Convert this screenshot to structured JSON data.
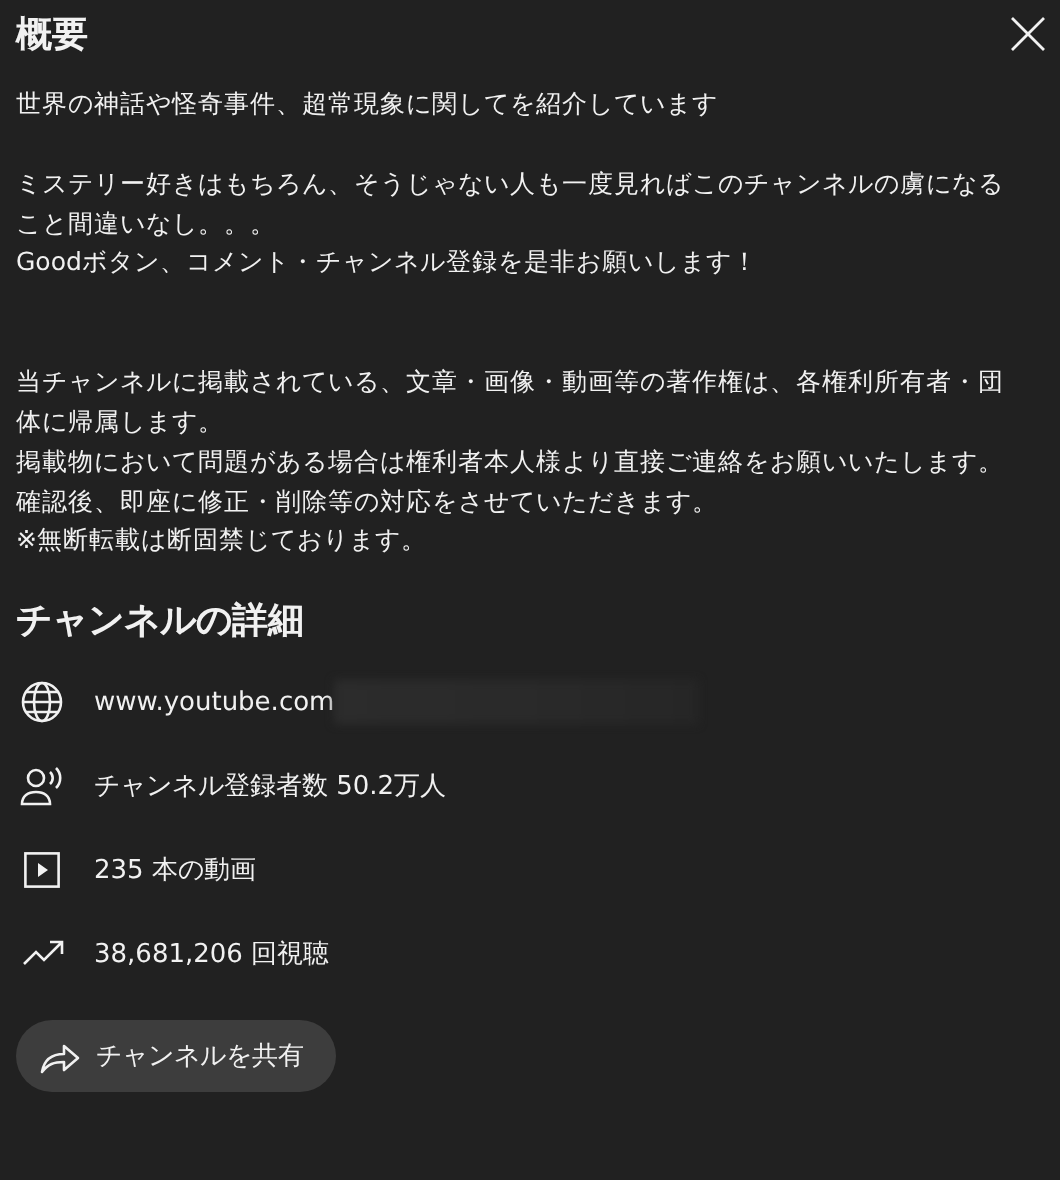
{
  "title": "概要",
  "description": [
    [
      "世界の神話や怪奇事件、超常現象に関してを紹介しています"
    ],
    [
      "ミステリー好きはもちろん、そうじゃない人も一度見ればこのチャンネルの虜になること間違いなし。。。",
      "Goodボタン、コメント・チャンネル登録を是非お願いします！"
    ],
    [
      "当チャンネルに掲載されている、文章・画像・動画等の著作権は、各権利所有者・団体に帰属します。",
      "掲載物において問題がある場合は権利者本人様より直接ご連絡をお願いいたします。",
      "確認後、即座に修正・削除等の対応をさせていただきます。",
      "※無断転載は断固禁じております。"
    ]
  ],
  "details_heading": "チャンネルの詳細",
  "details": [
    {
      "kind": "link",
      "text": "www.youtube.com",
      "redacted": true
    },
    {
      "kind": "subscribers",
      "text": "チャンネル登録者数 50.2万人"
    },
    {
      "kind": "videos",
      "text": "235 本の動画"
    },
    {
      "kind": "views",
      "text": "38,681,206 回視聴"
    }
  ],
  "share_button": "チャンネルを共有"
}
